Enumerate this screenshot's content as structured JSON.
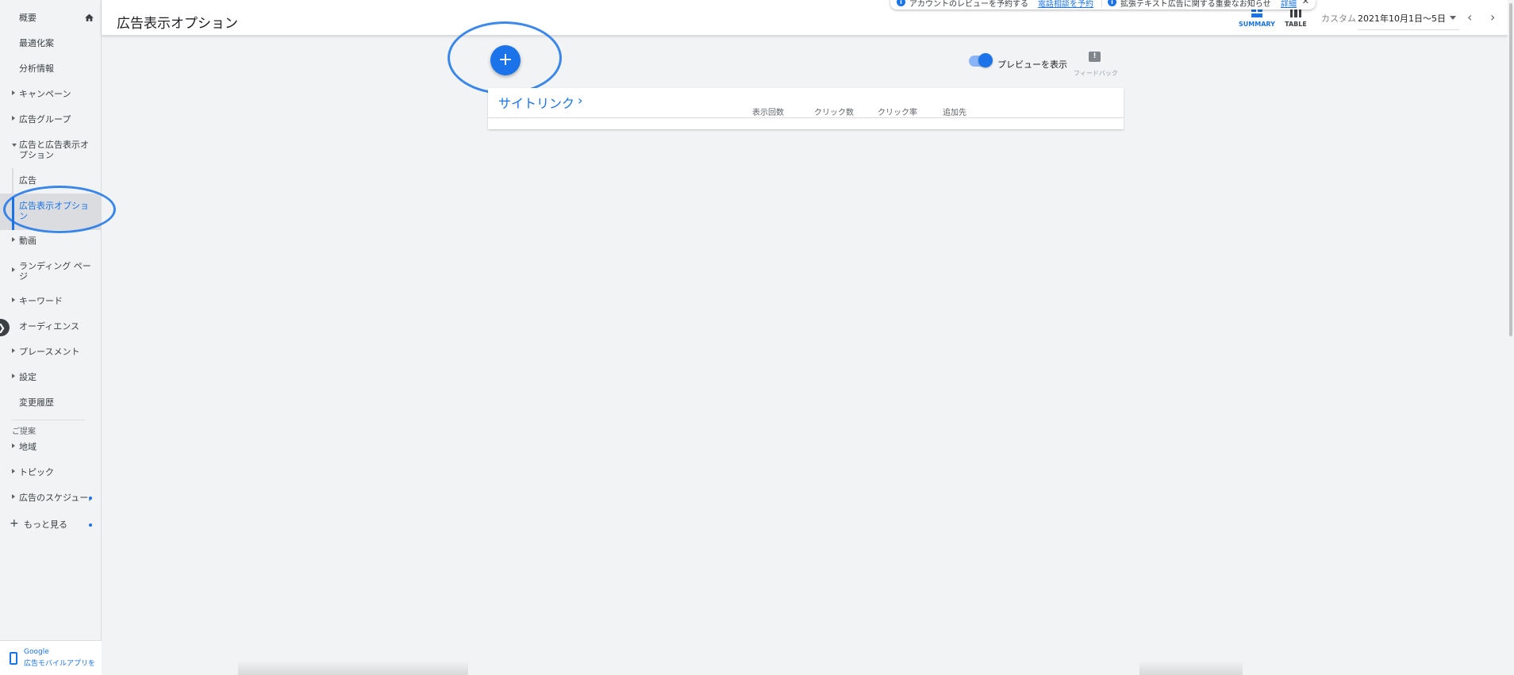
{
  "header": {
    "page_title": "広告表示オプション",
    "summary_label": "SUMMARY",
    "table_label": "TABLE",
    "custom_label": "カスタム",
    "date_range": "2021年10月1日〜5日"
  },
  "notice": {
    "text1": "アカウントのレビューを予約する",
    "link1": "電話相談を予約",
    "text2": "拡張テキスト広告に関する重要なお知らせ",
    "link2": "詳細"
  },
  "sidebar": {
    "items": [
      {
        "label": "概要"
      },
      {
        "label": "最適化案"
      },
      {
        "label": "分析情報"
      },
      {
        "label": "キャンペーン"
      },
      {
        "label": "広告グループ"
      },
      {
        "label": "広告と広告表示オプション"
      },
      {
        "label": "広告"
      },
      {
        "label": "広告表示オプション"
      },
      {
        "label": "動画"
      },
      {
        "label": "ランディング ページ"
      },
      {
        "label": "キーワード"
      },
      {
        "label": "オーディエンス"
      },
      {
        "label": "プレースメント"
      },
      {
        "label": "設定"
      },
      {
        "label": "変更履歴"
      }
    ],
    "section_label": "ご提案",
    "suggested": [
      {
        "label": "地域"
      },
      {
        "label": "トピック"
      },
      {
        "label": "広告のスケジュール"
      }
    ],
    "more_label": "もっと見る",
    "footer_line1": "Google",
    "footer_line2": "広告モバイルアプリを"
  },
  "main": {
    "preview_label": "プレビューを表示",
    "preview_on": true,
    "feedback_label": "フィードバック",
    "card_title": "サイトリンク",
    "columns": [
      "表示回数",
      "クリック数",
      "クリック率",
      "追加先"
    ]
  },
  "colors": {
    "accent": "#1a73e8",
    "background": "#f1f3f4"
  }
}
